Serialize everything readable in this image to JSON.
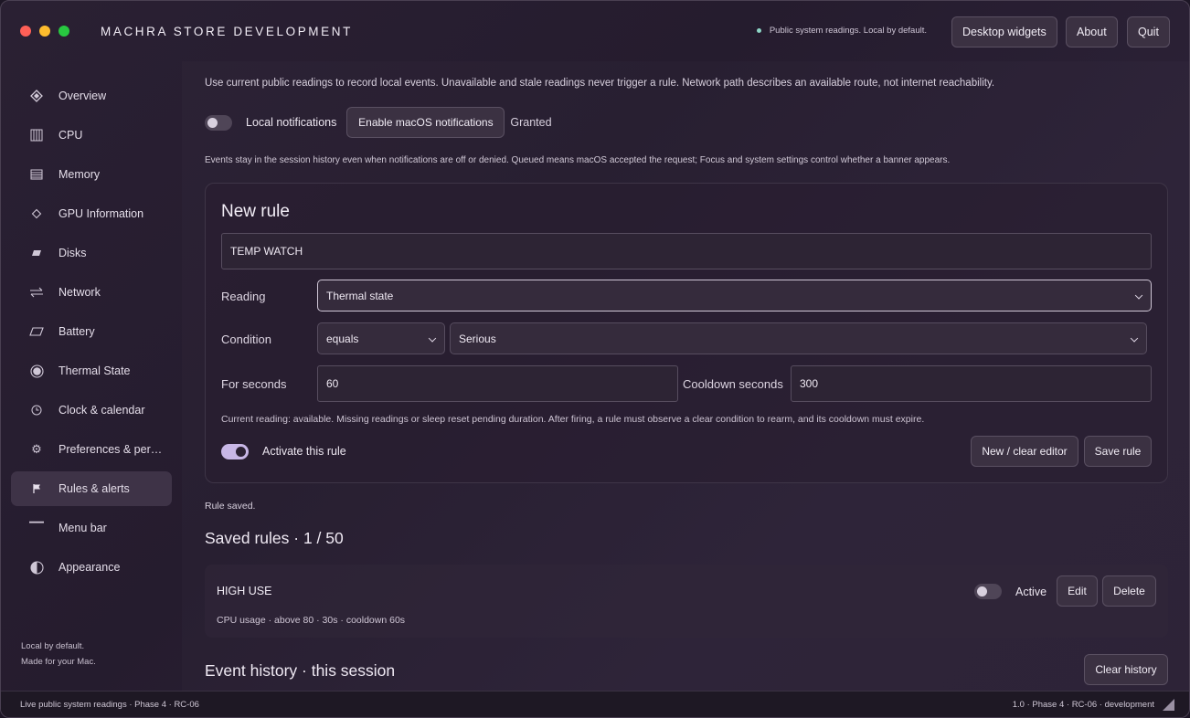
{
  "window": {
    "title": "MACHRA STORE DEVELOPMENT",
    "status_text": "Public system readings. Local by default.",
    "buttons": {
      "desktop_widgets": "Desktop widgets",
      "about": "About",
      "quit": "Quit"
    }
  },
  "sidebar": {
    "items": [
      {
        "label": "Overview",
        "icon": "diamond-icon"
      },
      {
        "label": "CPU",
        "icon": "cpu-icon"
      },
      {
        "label": "Memory",
        "icon": "memory-icon"
      },
      {
        "label": "GPU Information",
        "icon": "gpu-icon"
      },
      {
        "label": "Disks",
        "icon": "disk-icon"
      },
      {
        "label": "Network",
        "icon": "network-arrows-icon"
      },
      {
        "label": "Battery",
        "icon": "battery-icon"
      },
      {
        "label": "Thermal State",
        "icon": "thermal-icon"
      },
      {
        "label": "Clock & calendar",
        "icon": "clock-icon"
      },
      {
        "label": "Preferences & per…",
        "icon": "gear-icon"
      },
      {
        "label": "Rules & alerts",
        "icon": "flag-icon",
        "active": true
      },
      {
        "label": "Menu bar",
        "icon": "menubar-icon"
      },
      {
        "label": "Appearance",
        "icon": "contrast-icon"
      }
    ],
    "footer_line1": "Local by default.",
    "footer_line2": "Made for your Mac."
  },
  "main": {
    "intro": "Use current public readings to record local events. Unavailable and stale readings never trigger a rule. Network path describes an available route, not internet reachability.",
    "notifications": {
      "toggle_label": "Local notifications",
      "toggle_on": false,
      "enable_button": "Enable macOS notifications",
      "status": "Granted"
    },
    "note": "Events stay in the session history even when notifications are off or denied. Queued means macOS accepted the request; Focus and system settings control whether a banner appears.",
    "new_rule": {
      "title": "New rule",
      "name_value": "TEMP WATCH",
      "reading_label": "Reading",
      "reading_value": "Thermal state",
      "condition_label": "Condition",
      "condition_operator": "equals",
      "condition_value": "Serious",
      "for_seconds_label": "For seconds",
      "for_seconds_value": "60",
      "cooldown_label": "Cooldown seconds",
      "cooldown_value": "300",
      "hint": "Current reading: available. Missing readings or sleep reset pending duration. After firing, a rule must observe a clear condition to rearm, and its cooldown must expire.",
      "activate_label": "Activate this rule",
      "activate_on": true,
      "clear_button": "New / clear editor",
      "save_button": "Save rule"
    },
    "rule_saved": "Rule saved.",
    "saved_rules": {
      "title": "Saved rules · 1 / 50",
      "rules": [
        {
          "name": "HIGH USE",
          "summary": "CPU usage · above 80 · 30s · cooldown 60s",
          "active_label": "Active",
          "active_on": false,
          "edit": "Edit",
          "delete": "Delete"
        }
      ]
    },
    "history": {
      "title": "Event history · this session",
      "clear_button": "Clear history"
    }
  },
  "bottombar": {
    "left": "Live public system readings · Phase 4 · RC-06",
    "right": "1.0 · Phase 4 · RC-06 · development"
  }
}
